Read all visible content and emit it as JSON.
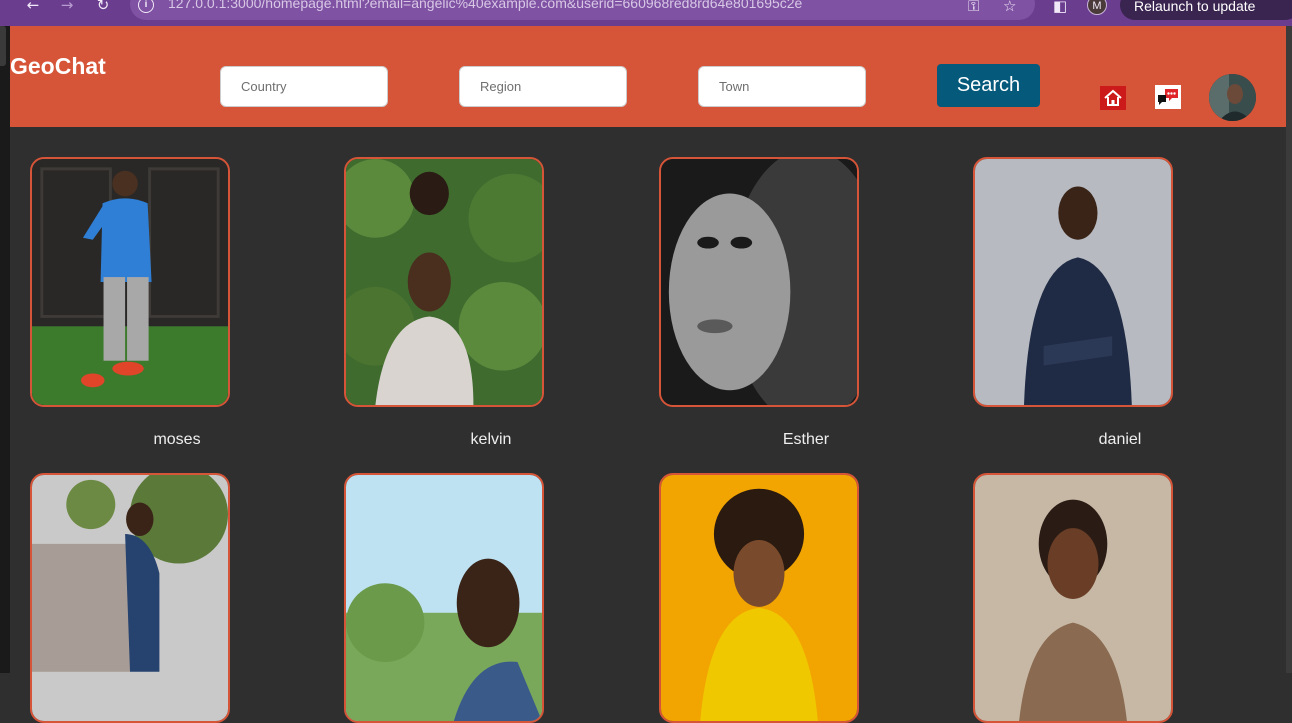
{
  "browser": {
    "url": "127.0.0.1:3000/homepage.html?email=angelic%40example.com&userid=660968red8rd64e801695c2e",
    "profile_initial": "M",
    "relaunch_label": "Relaunch to update"
  },
  "header": {
    "logo": "GeoChat",
    "country_placeholder": "Country",
    "region_placeholder": "Region",
    "town_placeholder": "Town",
    "search_label": "Search",
    "home_icon": "home-icon",
    "messages_icon": "chat-icon"
  },
  "users": [
    {
      "name": "moses"
    },
    {
      "name": "kelvin"
    },
    {
      "name": "Esther"
    },
    {
      "name": "daniel"
    },
    {
      "name": ""
    },
    {
      "name": ""
    },
    {
      "name": ""
    },
    {
      "name": ""
    }
  ],
  "colors": {
    "header": "#d65437",
    "page_background": "#2f2f2f",
    "search_button": "#055a7c",
    "card_border": "#d65437"
  }
}
